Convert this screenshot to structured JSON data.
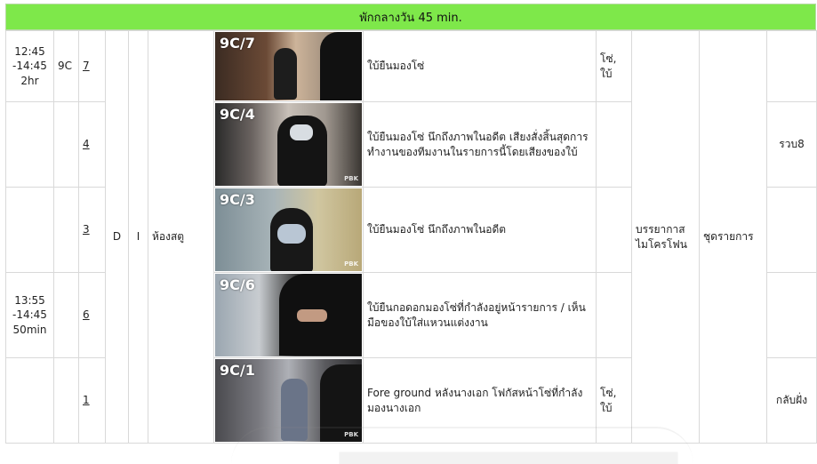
{
  "banner": "พักกลางวัน 45 min.",
  "rows": [
    {
      "time": "12:45\n-14:45\n2hr",
      "set": "9C",
      "scene": "7",
      "shot": "9C/7",
      "desc": "ใบ้ยืนมองโซ่",
      "cast": "โซ่,\nใบ้",
      "note": ""
    },
    {
      "time": "",
      "set": "",
      "scene": "4",
      "shot": "9C/4",
      "desc": "ใบ้ยืนมองโซ่ นึกถึงภาพในอดีต เสียงสั่งสิ้นสุดการทำงานของทีมงานในรายการนี้โดยเสียงของใบ้",
      "cast": "",
      "note": "รวบ8"
    },
    {
      "time": "",
      "set": "",
      "scene": "3",
      "shot": "9C/3",
      "desc": "ใบ้ยืนมองโซ่ นึกถึงภาพในอดีต",
      "cast": "",
      "note": ""
    },
    {
      "time": "13:55\n-14:45\n50min",
      "set": "",
      "scene": "6",
      "shot": "9C/6",
      "desc": "ใบ้ยืนกอดอกมองโซ่ที่กำลังอยู่หน้ารายการ / เห็นมือของใบ้ใส่แหวนแต่งงาน",
      "cast": "",
      "note": ""
    },
    {
      "time": "",
      "set": "",
      "scene": "1",
      "shot": "9C/1",
      "desc": "Fore ground หลังนางเอก โฟกัสหน้าโซ่ที่กำลังมองนางเอก",
      "cast": "โซ่,\nใบ้",
      "note": "กลับฝั่ง"
    }
  ],
  "merged": {
    "dn": "D",
    "ie": "I",
    "location": "ห้องสตู",
    "sound": "บรรยากาส\nไมโครโฟน",
    "costume": "ชุดรายการ"
  },
  "watermark_text": "PBK"
}
